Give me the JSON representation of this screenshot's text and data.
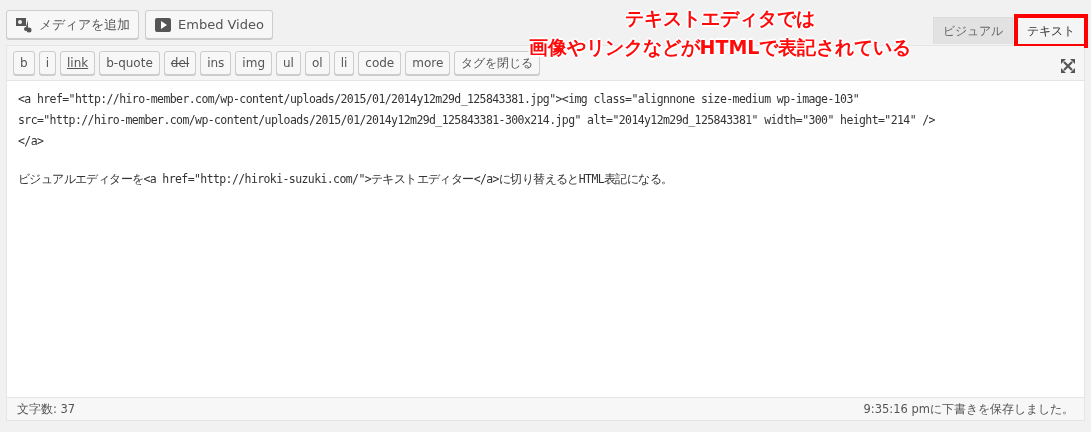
{
  "media_buttons": [
    {
      "kind": "media",
      "label": "メディアを追加"
    },
    {
      "kind": "video",
      "label": "Embed Video"
    }
  ],
  "annotation": {
    "lines": [
      "テキストエディタでは",
      "画像やリンクなどがHTMLで表記されている"
    ]
  },
  "tabs": [
    {
      "label": "ビジュアル",
      "selected": false,
      "highlighted": false
    },
    {
      "label": "テキスト",
      "selected": true,
      "highlighted": true
    }
  ],
  "toolbar": [
    {
      "label": "b",
      "kind": "plain"
    },
    {
      "label": "i",
      "kind": "plain"
    },
    {
      "label": "link",
      "kind": "link"
    },
    {
      "label": "b-quote",
      "kind": "plain"
    },
    {
      "label": "del",
      "kind": "strike"
    },
    {
      "label": "ins",
      "kind": "plain"
    },
    {
      "label": "img",
      "kind": "plain"
    },
    {
      "label": "ul",
      "kind": "plain"
    },
    {
      "label": "ol",
      "kind": "plain"
    },
    {
      "label": "li",
      "kind": "plain"
    },
    {
      "label": "code",
      "kind": "plain"
    },
    {
      "label": "more",
      "kind": "plain"
    },
    {
      "label": "タグを閉じる",
      "kind": "plain"
    }
  ],
  "content": [
    [
      "<a href=\"http://hiro-member.com/wp-content/uploads/2015/01/2014y12m29d_125843381.jpg\"><img class=\"alignnone size-medium wp-image-103\"",
      "src=\"http://hiro-member.com/wp-content/uploads/2015/01/2014y12m29d_125843381-300x214.jpg\" alt=\"2014y12m29d_125843381\" width=\"300\" height=\"214\" />",
      "</a>"
    ],
    [
      "ビジュアルエディターを<a href=\"http://hiroki-suzuki.com/\">テキストエディター</a>に切り替えるとHTML表記になる。"
    ]
  ],
  "status_bar": {
    "word_count": "文字数: 37",
    "saved": "9:35:16 pmに下書きを保存しました。"
  }
}
